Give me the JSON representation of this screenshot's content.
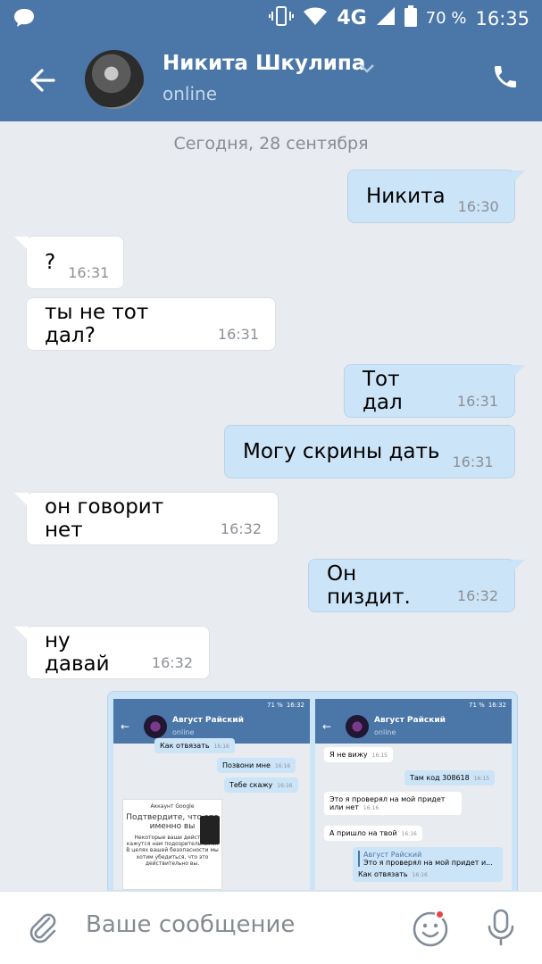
{
  "status_bar": {
    "network": "4G",
    "battery": "70 %",
    "time": "16:35"
  },
  "header": {
    "name": "Никита Шкулипа",
    "status": "online"
  },
  "chat": {
    "date": "Сегодня, 28 сентября",
    "messages": [
      {
        "dir": "out",
        "text": "Никита",
        "time": "16:30"
      },
      {
        "dir": "in",
        "text": "?",
        "time": "16:31"
      },
      {
        "dir": "in",
        "text": "ты не тот дал?",
        "time": "16:31"
      },
      {
        "dir": "out",
        "text": "Тот дал",
        "time": "16:31"
      },
      {
        "dir": "out",
        "text": "Могу скрины дать",
        "time": "16:31"
      },
      {
        "dir": "in",
        "text": "он говорит нет",
        "time": "16:32"
      },
      {
        "dir": "out",
        "text": "Он пиздит.",
        "time": "16:32"
      },
      {
        "dir": "in",
        "text": "ну давай",
        "time": "16:32"
      }
    ],
    "attachment": {
      "shot1": {
        "battery": "71 %",
        "time": "16:32",
        "name": "Август Райский",
        "status": "online",
        "m1": "Как отвязать",
        "m1_time": "16:16",
        "m2": "Позвони мне",
        "m2_time": "16:16",
        "m3": "Тебе скажу",
        "m3_time": "16:16",
        "card_head": "Аккаунт Google",
        "card_title": "Подтвердите, что это именно вы",
        "card_text": "Некоторые ваши действия кажутся нам подозрительными. В целях вашей безопасности мы хотим убедиться, что это действительно вы."
      },
      "shot2": {
        "battery": "71 %",
        "time": "16:32",
        "name": "Август Райский",
        "status": "online",
        "m1": "Я не вижу",
        "m1_time": "16:15",
        "m2": "Там код 308618",
        "m2_time": "16:15",
        "m3": "Это я проверял на мой придет или нет",
        "m3_time": "16:16",
        "m4": "А пришло на твой",
        "m4_time": "16:16",
        "reply_name": "Август Райский",
        "reply_text": "Это я проверял на мой придет и...",
        "m5": "Как отвязать",
        "m5_time": "16:16"
      }
    }
  },
  "composer": {
    "placeholder": "Ваше сообщение"
  },
  "colors": {
    "brand": "#4a76a8",
    "outgoing": "#cce4f7",
    "incoming": "#ffffff",
    "background": "#e8ebef"
  }
}
